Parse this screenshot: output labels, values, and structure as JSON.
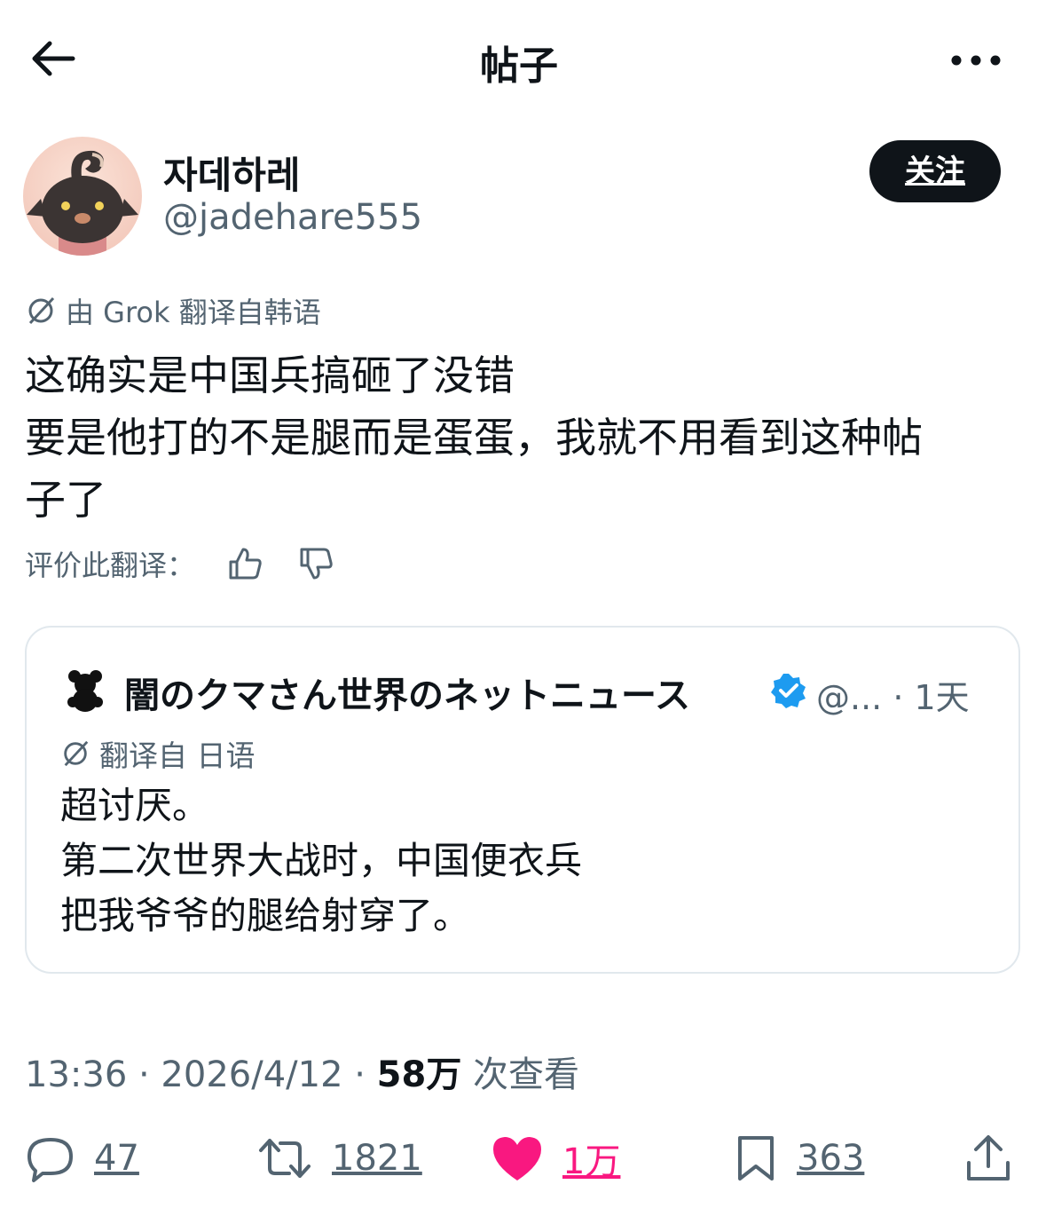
{
  "header": {
    "title": "帖子",
    "back_icon": "arrow-left-icon",
    "more_icon": "more-horizontal-icon"
  },
  "author": {
    "name": "자데하레",
    "handle": "@jadehare555",
    "follow_label": "关注"
  },
  "post": {
    "translation_note": "由 Grok 翻译自韩语",
    "lines": [
      "这确实是中国兵搞砸了没错",
      "要是他打的不是腿而是蛋蛋，我就不用看到这种帖",
      "子了"
    ],
    "rate_label": "评价此翻译："
  },
  "quote": {
    "name": "闇のクマさん世界のネットニュース",
    "meta": "@... · 1天",
    "translation_note": "翻译自 日语",
    "lines": [
      "超讨厌。",
      "第二次世界大战时，中国便衣兵",
      "把我爷爷的腿给射穿了。"
    ]
  },
  "meta": {
    "time": "13:36 · 2026/4/12 · ",
    "views": "58万",
    "views_label": " 次查看"
  },
  "actions": {
    "replies": "47",
    "reposts": "1821",
    "likes": "1万",
    "bookmarks": "363"
  },
  "colors": {
    "like": "#f91880",
    "verified": "#1d9bf0",
    "muted": "#536471"
  }
}
